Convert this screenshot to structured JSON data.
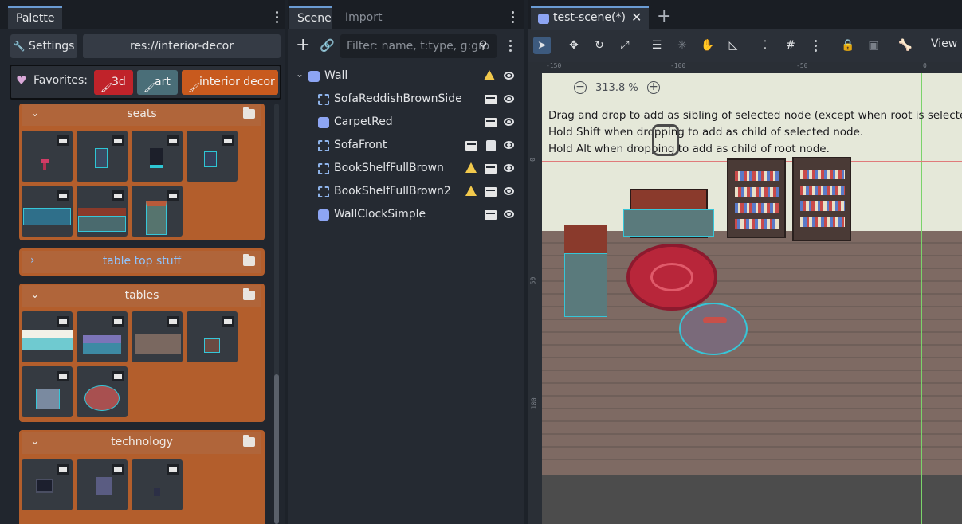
{
  "palette": {
    "tab": "Palette",
    "settings_label": "Settings",
    "path": "res://interior-decor",
    "favorites_label": "Favorites:",
    "favorites": [
      {
        "label": "3d",
        "color": "#c0232a"
      },
      {
        "label": "art",
        "color": "#4a6e78"
      },
      {
        "label": "interior decor",
        "color": "#c85a1e"
      }
    ],
    "sections": [
      {
        "title": "seats",
        "collapsed": false
      },
      {
        "title": "table top stuff",
        "collapsed": true
      },
      {
        "title": "tables",
        "collapsed": false
      },
      {
        "title": "technology",
        "collapsed": false
      }
    ]
  },
  "scene": {
    "tabs": [
      "Scene",
      "Import"
    ],
    "filter_placeholder": "Filter: name, t:type, g:gro",
    "root": "Wall",
    "nodes": [
      {
        "name": "SofaReddishBrownSide"
      },
      {
        "name": "CarpetRed"
      },
      {
        "name": "SofaFront"
      },
      {
        "name": "BookShelfFullBrown"
      },
      {
        "name": "BookShelfFullBrown2"
      },
      {
        "name": "WallClockSimple"
      }
    ]
  },
  "editor": {
    "tab": "test-scene(*)",
    "view_label": "View",
    "zoom": "313.8 %",
    "rulers": {
      "top": [
        "-150",
        "-100",
        "-50",
        "0"
      ],
      "left": [
        "0",
        "50",
        "100"
      ]
    },
    "hints": [
      "Drag and drop to add as sibling of selected node (except when root is selected).",
      "Hold Shift when dropping to add as child of selected node.",
      "Hold Alt when dropping to add as child of root node."
    ]
  },
  "colors": {
    "accent": "#6a9bd3",
    "section": "#b35e2c",
    "warning": "#f2c94c"
  }
}
